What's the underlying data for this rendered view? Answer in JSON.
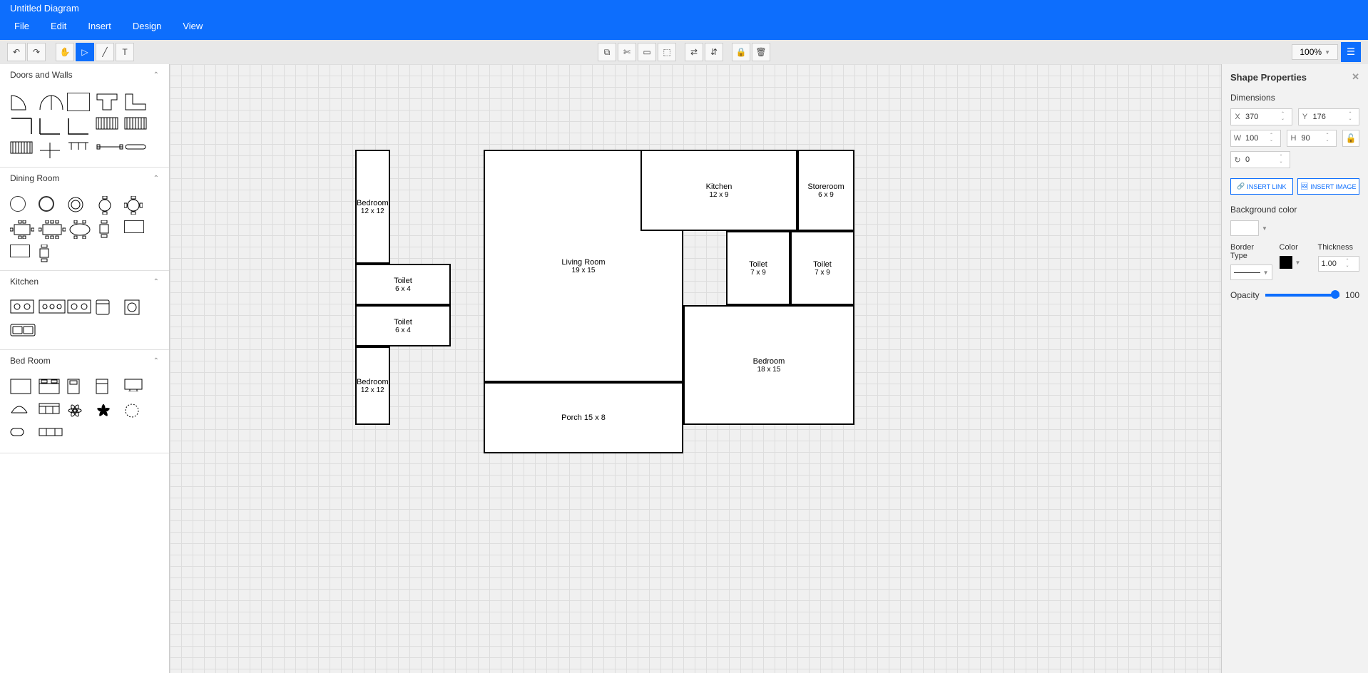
{
  "title": "Untitled Diagram",
  "menu": {
    "file": "File",
    "edit": "Edit",
    "insert": "Insert",
    "design": "Design",
    "view": "View"
  },
  "zoom": "100%",
  "categories": {
    "doors": "Doors and Walls",
    "dining": "Dining Room",
    "kitchen": "Kitchen",
    "bedroom": "Bed Room"
  },
  "rooms": {
    "bedroom1": {
      "name": "Bedroom",
      "size": "12 x 12"
    },
    "bedroom2": {
      "name": "Bedroom",
      "size": "12 x 12"
    },
    "bedroom3": {
      "name": "Bedroom",
      "size": "18 x 15"
    },
    "living": {
      "name": "Living Room",
      "size": "19 x 15"
    },
    "kitchen": {
      "name": "Kitchen",
      "size": "12 x 9"
    },
    "store": {
      "name": "Storeroom",
      "size": "6 x 9"
    },
    "toilet1": {
      "name": "Toilet",
      "size": "6 x 4"
    },
    "toilet2": {
      "name": "Toilet",
      "size": "6 x 4"
    },
    "toilet3": {
      "name": "Toilet",
      "size": "7 x 9"
    },
    "toilet4": {
      "name": "Toilet",
      "size": "7 x 9"
    },
    "porch": {
      "name": "Porch 15 x 8"
    }
  },
  "panel": {
    "title": "Shape Properties",
    "dimensions": "Dimensions",
    "x": "X",
    "xv": "370",
    "y": "Y",
    "yv": "176",
    "w": "W",
    "wv": "100",
    "h": "H",
    "hv": "90",
    "rot": "↻",
    "rotv": "0",
    "insertLink": "INSERT LINK",
    "insertImage": "INSERT IMAGE",
    "bgcolor": "Background color",
    "borderType": "Border Type",
    "color": "Color",
    "thickness": "Thickness",
    "thickv": "1.00",
    "opacity": "Opacity",
    "opv": "100"
  }
}
